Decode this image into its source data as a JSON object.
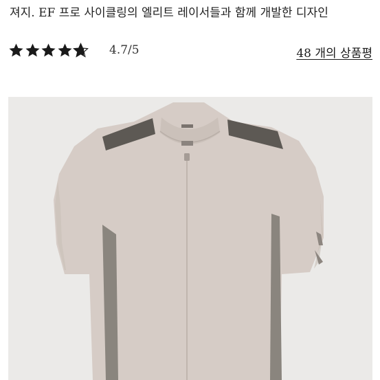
{
  "product": {
    "subtitle": "져지. EF 프로 사이클링의 엘리트 레이서들과 함께 개발한 디자인",
    "rating_value": "4.7/5",
    "rating_stars": 4.7,
    "reviews_link": "48 개의 상품평",
    "image": {
      "alt_icon": "jersey-image",
      "colors": {
        "body": "#d6ccc6",
        "panel": "#5d5954",
        "background": "#ebeae8"
      }
    }
  }
}
